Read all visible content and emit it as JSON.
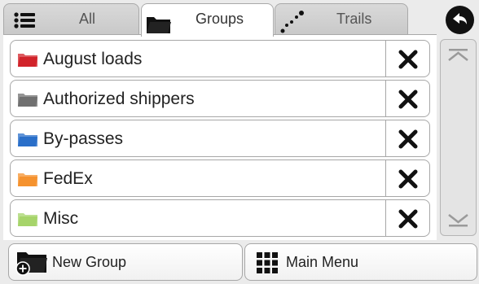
{
  "tabs": [
    {
      "label": "All",
      "icon": "list-icon",
      "active": false
    },
    {
      "label": "Groups",
      "icon": "folder-icon",
      "active": true
    },
    {
      "label": "Trails",
      "icon": "trail-dots-icon",
      "active": false
    }
  ],
  "back_button": {
    "icon": "back-arrow-icon"
  },
  "groups": [
    {
      "label": "August loads",
      "color": "#d1232a"
    },
    {
      "label": "Authorized shippers",
      "color": "#707070"
    },
    {
      "label": "By-passes",
      "color": "#2a6fc9"
    },
    {
      "label": "FedEx",
      "color": "#f5922e"
    },
    {
      "label": "Misc",
      "color": "#a6d46a"
    }
  ],
  "delete_icon": "close-x-icon",
  "scrollbar": {
    "up_icon": "scroll-top-icon",
    "down_icon": "scroll-bottom-icon"
  },
  "footer": {
    "new_group_label": "New Group",
    "new_group_icon": "folder-add-icon",
    "main_menu_label": "Main Menu",
    "main_menu_icon": "grid-icon"
  }
}
